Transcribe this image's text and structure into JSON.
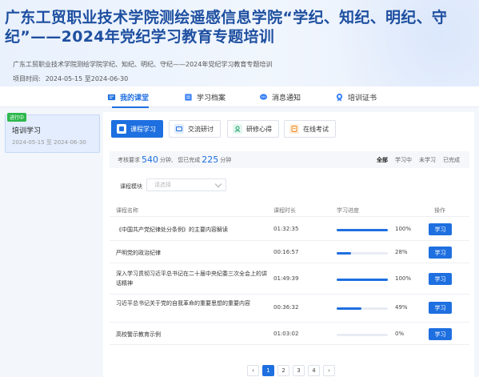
{
  "banner": {
    "title": "广东工贸职业技术学院测绘遥感信息学院“学纪、知纪、明纪、守纪”——2024年党纪学习教育专题培训",
    "subtitle": "广东工贸职业技术学院测绘学院学纪、知纪、明纪、守纪——2024年党纪学习教育专题培训",
    "period_label": "项目时间:",
    "period_value": "2024-05-15 至2024-06-30"
  },
  "nav": {
    "tabs": [
      {
        "label": "我的课堂",
        "icon": "course-icon",
        "active": true
      },
      {
        "label": "学习档案",
        "icon": "archive-icon",
        "active": false
      },
      {
        "label": "消息通知",
        "icon": "message-icon",
        "active": false
      },
      {
        "label": "培训证书",
        "icon": "certificate-icon",
        "active": false
      }
    ]
  },
  "left": {
    "badge": "进行中",
    "name": "培训学习",
    "dates": "2024-05-15 至 2024-06-30"
  },
  "categories": [
    {
      "label": "课程学习",
      "icon": "course-learning-icon",
      "active": true
    },
    {
      "label": "交流研讨",
      "icon": "discussion-icon",
      "active": false
    },
    {
      "label": "研修心得",
      "icon": "reflection-icon",
      "active": false
    },
    {
      "label": "在线考试",
      "icon": "exam-icon",
      "active": false
    }
  ],
  "summary": {
    "required_label": "考核要求",
    "required_value": "540",
    "required_unit": "分钟,",
    "done_label": "您已完成",
    "done_value": "225",
    "done_unit": "分钟"
  },
  "filters": [
    "全部",
    "学习中",
    "未学习",
    "已完成"
  ],
  "module": {
    "label": "课程模块",
    "placeholder": "请选择"
  },
  "table": {
    "headers": [
      "课程名称",
      "课程时长",
      "学习进度",
      "操作"
    ],
    "rows": [
      {
        "name": "《中国共产党纪律处分条例》的主要内容解读",
        "duration": "01:32:35",
        "progress": 100,
        "pct_label": "100%",
        "action": "学习"
      },
      {
        "name": "严明党的政治纪律",
        "duration": "00:16:57",
        "progress": 28,
        "pct_label": "28%",
        "action": "学习"
      },
      {
        "name": "深入学习贯彻习近平总书记在二十届中央纪委三次全会上的讲话精神",
        "duration": "01:49:39",
        "progress": 100,
        "pct_label": "100%",
        "action": "学习"
      },
      {
        "name": "习近平总书记关于党的自我革命的重要思想的重要内容",
        "duration": "00:36:32",
        "progress": 49,
        "pct_label": "49%",
        "action": "学习"
      },
      {
        "name": "高校警示教育示例",
        "duration": "01:03:02",
        "progress": 0,
        "pct_label": "0%",
        "action": "学习"
      }
    ]
  },
  "pager": {
    "prev": "‹",
    "pages": [
      "1",
      "2",
      "3",
      "4"
    ],
    "next": "›",
    "current": "1"
  },
  "colors": {
    "accent": "#1e6fe0",
    "title": "#1e4fa0",
    "badge": "#2db84d"
  }
}
